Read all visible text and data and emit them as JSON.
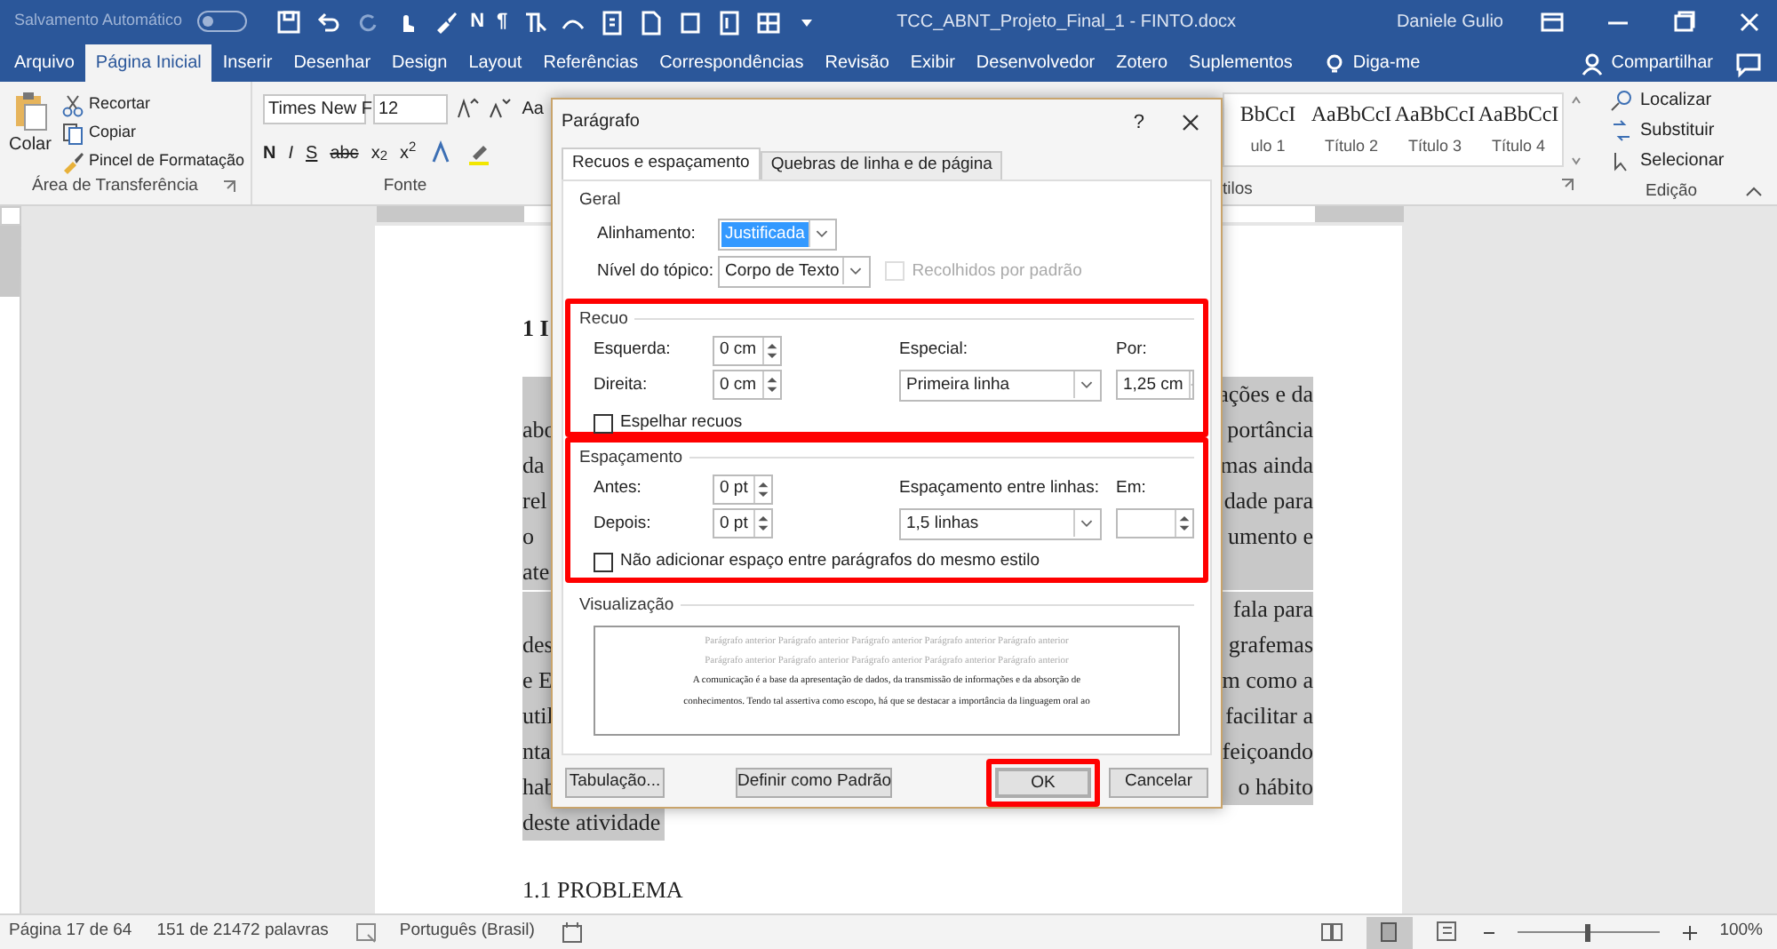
{
  "title_bar": {
    "autosave_label": "Salvamento Automático",
    "autosave_on": false,
    "qat_glyphs": [
      "N",
      "¶"
    ],
    "document_title": "TCC_ABNT_Projeto_Final_1 - FINTO.docx",
    "user": "Daniele Gulio"
  },
  "ribbon_tabs": [
    {
      "label": "Arquivo",
      "selected": false
    },
    {
      "label": "Página Inicial",
      "selected": true
    },
    {
      "label": "Inserir",
      "selected": false
    },
    {
      "label": "Desenhar",
      "selected": false
    },
    {
      "label": "Design",
      "selected": false
    },
    {
      "label": "Layout",
      "selected": false
    },
    {
      "label": "Referências",
      "selected": false
    },
    {
      "label": "Correspondências",
      "selected": false
    },
    {
      "label": "Revisão",
      "selected": false
    },
    {
      "label": "Exibir",
      "selected": false
    },
    {
      "label": "Desenvolvedor",
      "selected": false
    },
    {
      "label": "Zotero",
      "selected": false
    },
    {
      "label": "Suplementos",
      "selected": false
    }
  ],
  "tell_me": "Diga-me",
  "share": "Compartilhar",
  "clipboard": {
    "paste": "Colar",
    "items": [
      "Recortar",
      "Copiar",
      "Pincel de Formatação"
    ],
    "group": "Área de Transferência"
  },
  "font": {
    "name": "Times New F",
    "size": "12",
    "case_button": "Aa",
    "buttons": [
      "N",
      "I",
      "S",
      "abc",
      "x$_{2}$",
      "x$^{2}$"
    ],
    "group": "Fonte"
  },
  "styles": [
    {
      "preview": "BbCcI",
      "name": "ulo 1"
    },
    {
      "preview": "AaBbCcI",
      "name": "Título 2"
    },
    {
      "preview": "AaBbCcI",
      "name": "Título 3"
    },
    {
      "preview": "AaBbCcI",
      "name": "Título 4"
    }
  ],
  "styles_group": "tilos",
  "editing": {
    "items": [
      "Localizar",
      "Substituir",
      "Selecionar"
    ],
    "group": "Edição"
  },
  "document": {
    "heading": "1 I",
    "paragraphs": [
      [
        {
          "right": "ações e da"
        },
        {
          "left": "abo",
          "right": "portância"
        },
        {
          "left": "da",
          "right": "mas ainda"
        },
        {
          "left": "rel",
          "right": "dade para"
        },
        {
          "left": "o",
          "right": "umento e"
        },
        {
          "left": "ate"
        }
      ],
      [
        {
          "right": "fala para"
        },
        {
          "left": "des",
          "right": "grafemas"
        },
        {
          "left": "e E",
          "right": "m como a"
        },
        {
          "left": "util",
          "right": "facilitar a"
        },
        {
          "left": "nta",
          "right": "feiçoando"
        },
        {
          "left": "hab",
          "right": "o hábito"
        },
        {
          "left": "deste atividade"
        }
      ]
    ],
    "subheading": "1.1 PROBLEMA"
  },
  "dialog": {
    "title": "Parágrafo",
    "help": "?",
    "tabs": [
      {
        "label": "Recuos e espaçamento",
        "selected": true
      },
      {
        "label": "Quebras de linha e de página",
        "selected": false
      }
    ],
    "general": {
      "heading": "Geral",
      "alignment_label": "Alinhamento:",
      "alignment": "Justificada",
      "outline_label": "Nível do tópico:",
      "outline": "Corpo de Texto",
      "collapsed_label": "Recolhidos por padrão",
      "collapsed_checked": false
    },
    "indent": {
      "heading": "Recuo",
      "highlighted": true,
      "left_label": "Esquerda:",
      "left": "0 cm",
      "right_label": "Direita:",
      "right": "0 cm",
      "special_label": "Especial:",
      "special": "Primeira linha",
      "by_label": "Por:",
      "by": "1,25 cm",
      "mirror_label": "Espelhar recuos",
      "mirror_checked": false
    },
    "spacing": {
      "heading": "Espaçamento",
      "highlighted": true,
      "before_label": "Antes:",
      "before": "0 pt",
      "after_label": "Depois:",
      "after": "0 pt",
      "line_label": "Espaçamento entre linhas:",
      "line": "1,5 linhas",
      "at_label": "Em:",
      "no_space_label": "Não adicionar espaço entre parágrafos do mesmo estilo",
      "no_space_checked": false
    },
    "preview": {
      "heading": "Visualização",
      "previous": [
        "Parágrafo anterior Parágrafo anterior Parágrafo anterior Parágrafo anterior Parágrafo anterior",
        "Parágrafo anterior Parágrafo anterior Parágrafo anterior Parágrafo anterior Parágrafo anterior"
      ],
      "current": [
        "A comunicação é a base da apresentação de dados, da transmissão de informações e da absorção de",
        "conhecimentos. Tendo tal assertiva como escopo, há que se destacar a importância da linguagem oral ao"
      ]
    },
    "buttons": [
      {
        "label": "Tabulação...",
        "kind": "left",
        "highlighted": false
      },
      {
        "label": "Definir como Padrão",
        "kind": "middle",
        "highlighted": false
      },
      {
        "label": "OK",
        "kind": "default",
        "highlighted": true
      },
      {
        "label": "Cancelar",
        "kind": "right",
        "highlighted": false
      }
    ]
  },
  "status_bar": {
    "page": "Página 17 de 64",
    "words": "151 de 21472 palavras",
    "language": "Português (Brasil)",
    "zoom_slider": {
      "level": 0.5
    },
    "zoom": "100%"
  }
}
